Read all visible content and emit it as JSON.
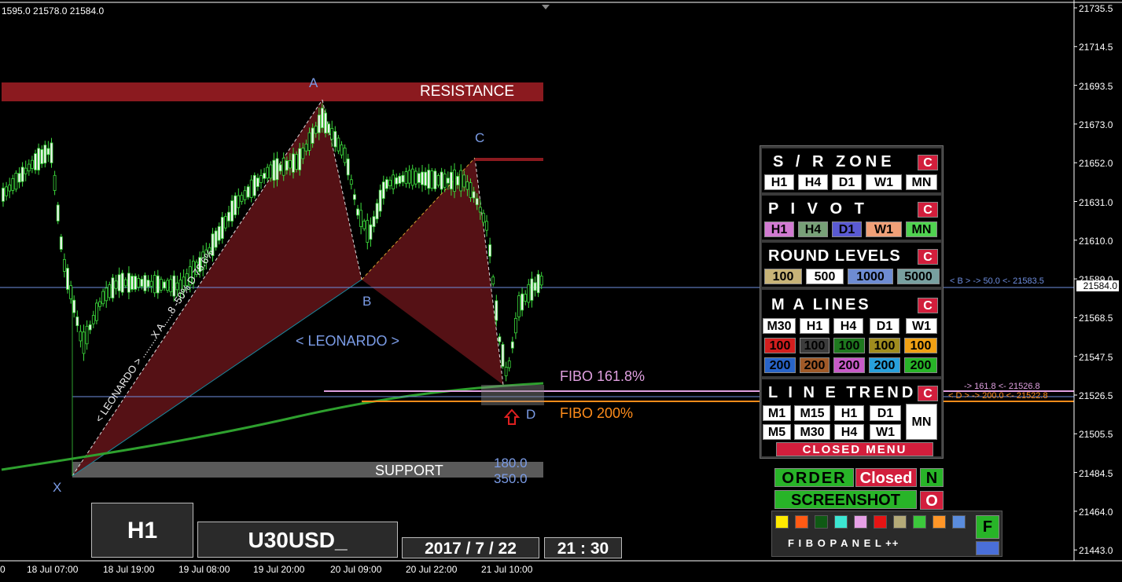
{
  "ohlc_text": "1595.0 21578.0 21584.0",
  "current_price": "21584.0",
  "y_axis": {
    "labels": [
      "21735.5",
      "21714.5",
      "21693.5",
      "21673.0",
      "21652.0",
      "21631.0",
      "21610.0",
      "21589.0",
      "21568.5",
      "21547.5",
      "21526.5",
      "21505.5",
      "21484.5",
      "21464.0",
      "21443.0"
    ]
  },
  "x_axis": {
    "labels": [
      "0",
      "18 Jul 07:00",
      "18 Jul 19:00",
      "19 Jul 08:00",
      "19 Jul 20:00",
      "20 Jul 09:00",
      "20 Jul 22:00",
      "21 Jul 10:00"
    ]
  },
  "chart_data": {
    "type": "candlestick",
    "symbol": "U30USD_",
    "timeframe": "H1",
    "ylim": [
      21440,
      21740
    ],
    "pattern": {
      "name": "< LEONARDO >",
      "points": {
        "X": 21479.0,
        "A": 21684.0,
        "B": 21578.0,
        "C": 21655.0,
        "D": 21525.0
      },
      "xa_label": "< LEONARDO > ........X A.....8 -50% D 78.6%"
    },
    "zones": [
      {
        "name": "RESISTANCE",
        "from": 21683.0,
        "to": 21696.0
      },
      {
        "name": "SUPPORT",
        "from": 21478.0,
        "to": 21488.0
      }
    ],
    "levels": [
      {
        "name": "FIBO 161.8%",
        "value": 21526.8,
        "color": "#e0a0e0"
      },
      {
        "name": "FIBO 200%",
        "value": 21522.8,
        "color": "#ff8c1a"
      },
      {
        "name": "< B > -> 50.0 <-",
        "value": 21583.5,
        "color": "#7b9ce6"
      }
    ],
    "right_labels": [
      {
        "text": "< B > -> 50.0 <-   21583.5"
      },
      {
        "text": "-> 161.8 <-   21526.8"
      },
      {
        "text": "< D > -> 200.0 <-   21522.8"
      }
    ],
    "d_values": [
      "180.0",
      "350.0"
    ],
    "fibo_161_text": "FIBO 161.8%",
    "fibo_200_text": "FIBO 200%"
  },
  "labels": {
    "A": "A",
    "B": "B",
    "C": "C",
    "D": "D",
    "X": "X",
    "resistance": "RESISTANCE",
    "support": "SUPPORT",
    "leonardo": "< LEONARDO >"
  },
  "panel": {
    "sr_zone": {
      "title": "S / R  ZONE",
      "close": "C",
      "buttons": [
        "H1",
        "H4",
        "D1",
        "W1",
        "MN"
      ]
    },
    "pivot": {
      "title": "P I V O T",
      "close": "C",
      "buttons": [
        "H1",
        "H4",
        "D1",
        "W1",
        "MN"
      ]
    },
    "round_levels": {
      "title": "ROUND LEVELS",
      "close": "C",
      "buttons": [
        "100",
        "500",
        "1000",
        "5000"
      ]
    },
    "ma_lines": {
      "title": "M A  LINES",
      "close": "C",
      "tf": [
        "M30",
        "H1",
        "H4",
        "D1",
        "W1"
      ],
      "row1": [
        "100",
        "100",
        "100",
        "100",
        "100"
      ],
      "row2": [
        "200",
        "200",
        "200",
        "200",
        "200"
      ]
    },
    "line_trend": {
      "title": "L I N E  TREND",
      "close": "C",
      "row1": [
        "M1",
        "M15",
        "H1",
        "D1"
      ],
      "row2": [
        "M5",
        "M30",
        "H4",
        "W1"
      ],
      "mn": "MN",
      "closed_menu": "CLOSED  MENU"
    }
  },
  "order": {
    "label": "ORDER",
    "status": "Closed",
    "toggle": "N"
  },
  "screenshot": {
    "label": "SCREENSHOT",
    "toggle": "O"
  },
  "fibo_panel": {
    "label": "F I B O   P A N E L  ++",
    "toggle": "F",
    "colors": [
      "#ffea00",
      "#ff5a14",
      "#0f5a14",
      "#3ce6d2",
      "#e6a0e6",
      "#e61414",
      "#b4aa78",
      "#3cc83c",
      "#ff9628",
      "#5a8cdc"
    ],
    "side_color": "#4a6fd8"
  },
  "info": {
    "timeframe": "H1",
    "symbol": "U30USD_",
    "date": "2017 / 7 / 22",
    "time": "21 : 30"
  }
}
